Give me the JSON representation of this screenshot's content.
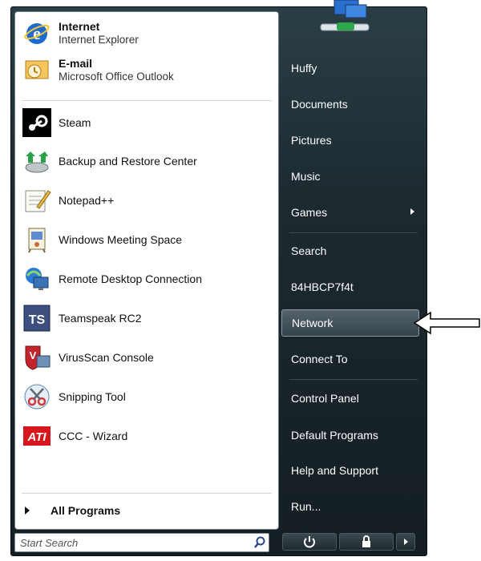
{
  "pinned": [
    {
      "title": "Internet",
      "subtitle": "Internet Explorer",
      "icon": "internet-explorer-icon"
    },
    {
      "title": "E-mail",
      "subtitle": "Microsoft Office Outlook",
      "icon": "outlook-icon"
    }
  ],
  "recent": [
    {
      "label": "Steam",
      "icon": "steam-icon"
    },
    {
      "label": "Backup and Restore Center",
      "icon": "backup-restore-icon"
    },
    {
      "label": "Notepad++",
      "icon": "notepad-icon"
    },
    {
      "label": "Windows Meeting Space",
      "icon": "meeting-space-icon"
    },
    {
      "label": "Remote Desktop Connection",
      "icon": "remote-desktop-icon"
    },
    {
      "label": "Teamspeak RC2",
      "icon": "teamspeak-icon"
    },
    {
      "label": "VirusScan Console",
      "icon": "virusscan-icon"
    },
    {
      "label": "Snipping Tool",
      "icon": "snipping-tool-icon"
    },
    {
      "label": "CCC - Wizard",
      "icon": "ati-icon",
      "brand": "ATI"
    }
  ],
  "all_programs": "All Programs",
  "search_placeholder": "Start Search",
  "right_items": [
    {
      "label": "Huffy"
    },
    {
      "label": "Documents"
    },
    {
      "label": "Pictures"
    },
    {
      "label": "Music"
    },
    {
      "label": "Games"
    },
    {
      "label": "Search"
    },
    {
      "label": "84HBCP7f4t"
    },
    {
      "label": "Network"
    },
    {
      "label": "Connect To"
    },
    {
      "label": "Control Panel"
    },
    {
      "label": "Default Programs"
    },
    {
      "label": "Help and Support"
    },
    {
      "label": "Run..."
    }
  ],
  "colors": {
    "accent": "#2a3f45",
    "highlight": "#55646a",
    "text_light": "#ffffff"
  }
}
